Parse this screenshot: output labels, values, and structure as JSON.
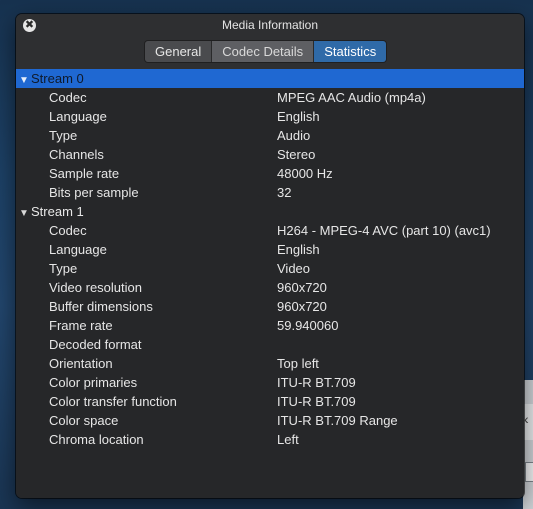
{
  "window": {
    "title": "Media Information",
    "close_glyph": "✖"
  },
  "tabs": [
    {
      "label": "General"
    },
    {
      "label": "Codec Details"
    },
    {
      "label": "Statistics"
    }
  ],
  "desktop": {
    "partial_button_glyph": "‹"
  },
  "streams": [
    {
      "label": "Stream 0",
      "expanded": true,
      "selected": true,
      "properties": [
        {
          "name": "Codec",
          "value": "MPEG AAC Audio (mp4a)"
        },
        {
          "name": "Language",
          "value": "English"
        },
        {
          "name": "Type",
          "value": "Audio"
        },
        {
          "name": "Channels",
          "value": "Stereo"
        },
        {
          "name": "Sample rate",
          "value": "48000 Hz"
        },
        {
          "name": "Bits per sample",
          "value": "32"
        }
      ]
    },
    {
      "label": "Stream 1",
      "expanded": true,
      "selected": false,
      "properties": [
        {
          "name": "Codec",
          "value": "H264 - MPEG-4 AVC (part 10) (avc1)"
        },
        {
          "name": "Language",
          "value": "English"
        },
        {
          "name": "Type",
          "value": "Video"
        },
        {
          "name": "Video resolution",
          "value": "960x720"
        },
        {
          "name": "Buffer dimensions",
          "value": "960x720"
        },
        {
          "name": "Frame rate",
          "value": "59.940060"
        },
        {
          "name": "Decoded format",
          "value": ""
        },
        {
          "name": "Orientation",
          "value": "Top left"
        },
        {
          "name": "Color primaries",
          "value": "ITU-R BT.709"
        },
        {
          "name": "Color transfer function",
          "value": "ITU-R BT.709"
        },
        {
          "name": "Color space",
          "value": "ITU-R BT.709 Range"
        },
        {
          "name": "Chroma location",
          "value": "Left"
        }
      ]
    }
  ]
}
